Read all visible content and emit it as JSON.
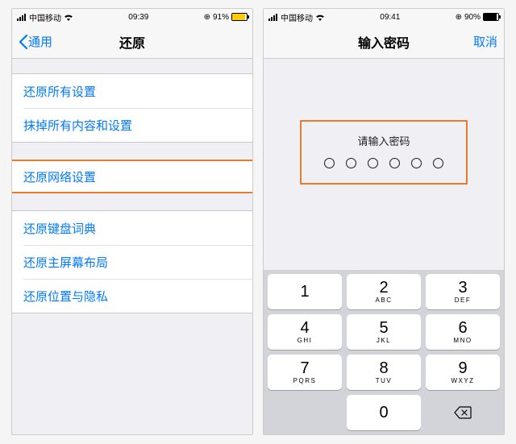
{
  "left": {
    "status": {
      "carrier": "中国移动",
      "time": "09:39",
      "battery": "91%"
    },
    "nav": {
      "back": "通用",
      "title": "还原"
    },
    "groups": [
      {
        "rows": [
          "还原所有设置",
          "抹掉所有内容和设置"
        ]
      },
      {
        "rows": [
          "还原网络设置"
        ],
        "highlight": 0
      },
      {
        "rows": [
          "还原键盘词典",
          "还原主屏幕布局",
          "还原位置与隐私"
        ]
      }
    ]
  },
  "right": {
    "status": {
      "carrier": "中国移动",
      "time": "09:41",
      "battery": "90%"
    },
    "nav": {
      "title": "输入密码",
      "cancel": "取消"
    },
    "prompt": "请输入密码",
    "keypad": [
      {
        "n": "1",
        "s": ""
      },
      {
        "n": "2",
        "s": "ABC"
      },
      {
        "n": "3",
        "s": "DEF"
      },
      {
        "n": "4",
        "s": "GHI"
      },
      {
        "n": "5",
        "s": "JKL"
      },
      {
        "n": "6",
        "s": "MNO"
      },
      {
        "n": "7",
        "s": "PQRS"
      },
      {
        "n": "8",
        "s": "TUV"
      },
      {
        "n": "9",
        "s": "WXYZ"
      },
      {
        "blank": true
      },
      {
        "n": "0",
        "s": ""
      },
      {
        "del": true
      }
    ]
  }
}
